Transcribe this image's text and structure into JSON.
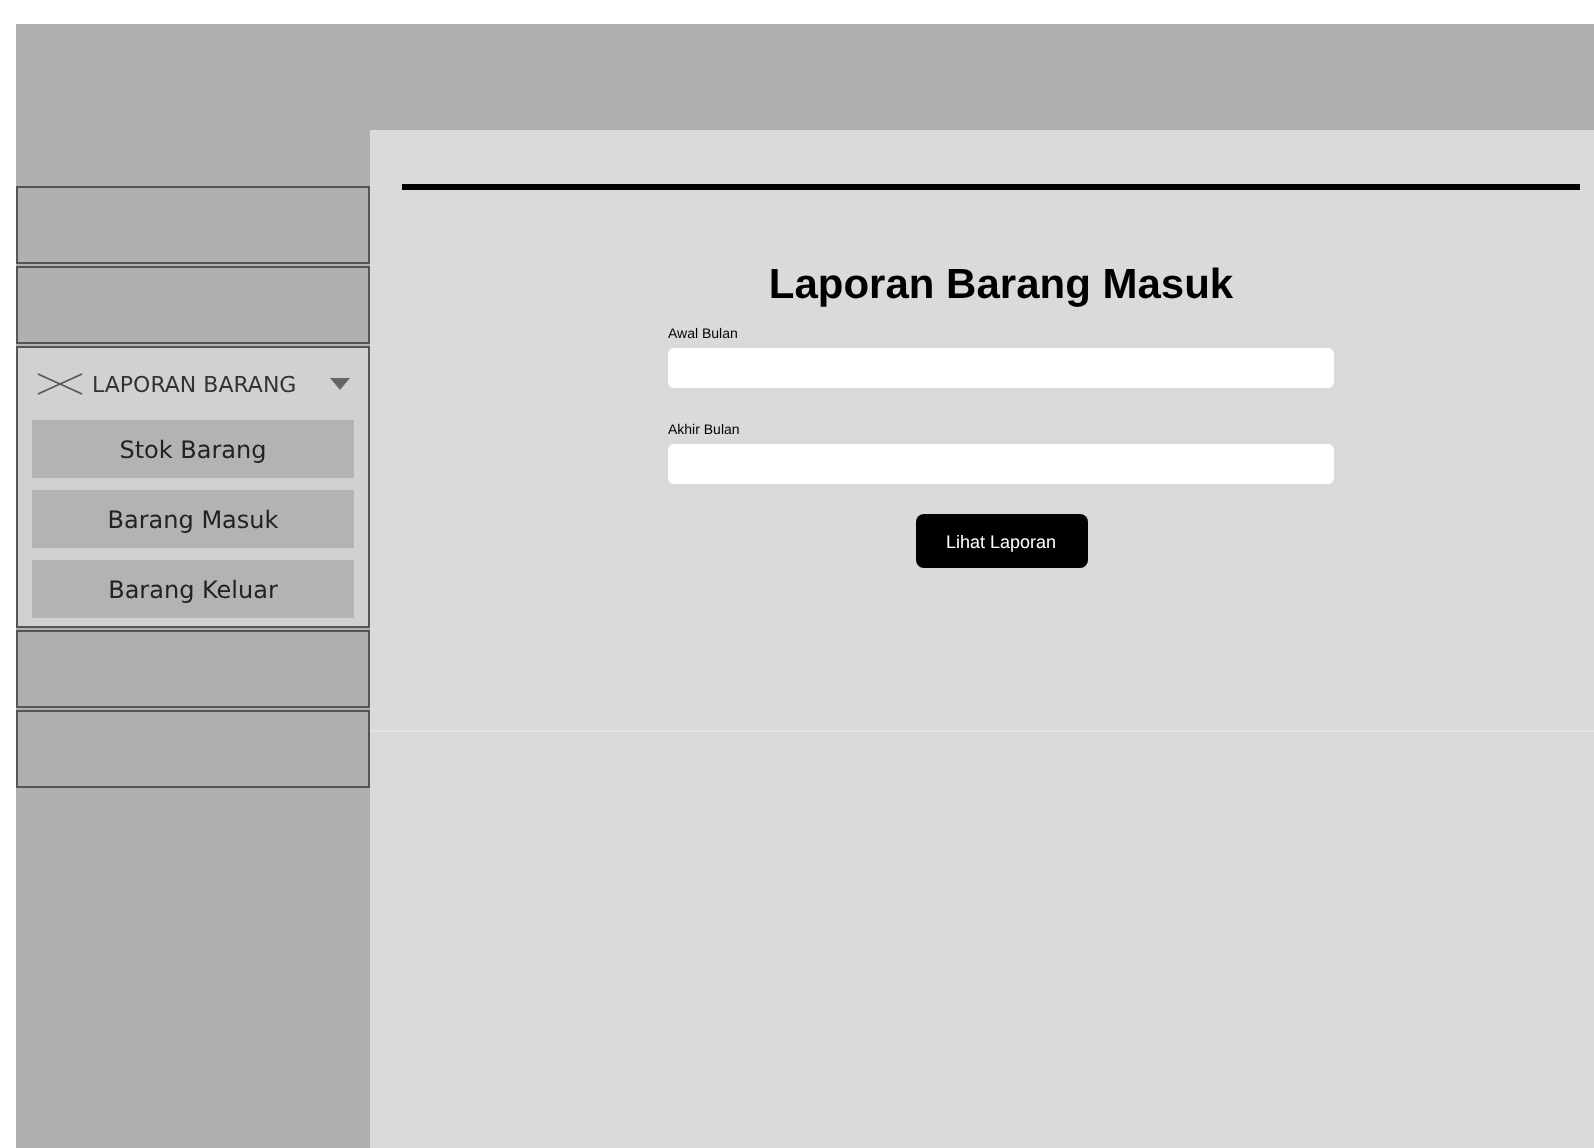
{
  "sidebar": {
    "items": [
      {
        "kind": "blank"
      },
      {
        "kind": "blank"
      },
      {
        "kind": "group",
        "label": "LAPORAN BARANG",
        "expanded": true,
        "children": [
          {
            "label": "Stok Barang"
          },
          {
            "label": "Barang Masuk"
          },
          {
            "label": "Barang Keluar"
          }
        ]
      },
      {
        "kind": "blank"
      },
      {
        "kind": "blank"
      }
    ]
  },
  "form": {
    "title": "Laporan Barang Masuk",
    "fields": [
      {
        "label": "Awal Bulan"
      },
      {
        "label": "Akhir Bulan"
      }
    ],
    "button": "Lihat Laporan"
  }
}
